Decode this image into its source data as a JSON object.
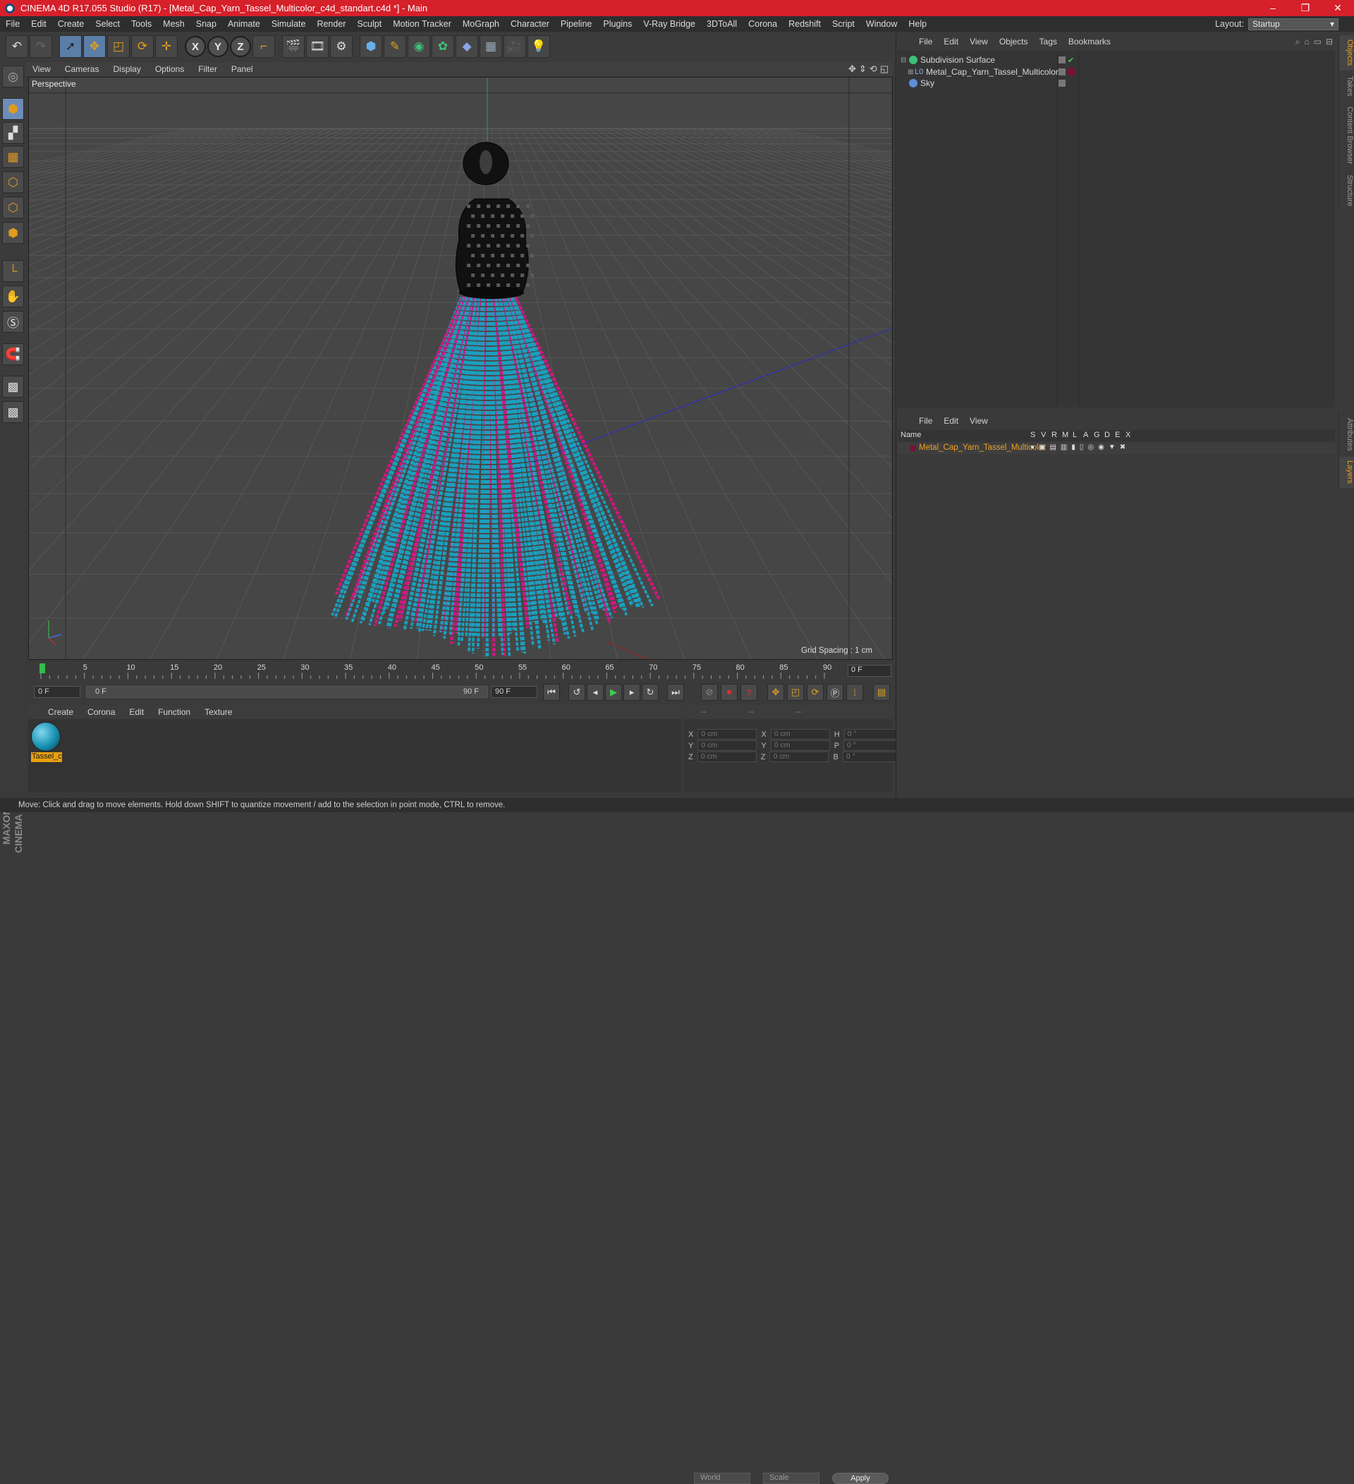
{
  "window": {
    "title": "CINEMA 4D R17.055 Studio (R17) - [Metal_Cap_Yarn_Tassel_Multicolor_c4d_standart.c4d *] - Main",
    "minimize": "–",
    "maximize": "❐",
    "close": "✕"
  },
  "menu": [
    "File",
    "Edit",
    "Create",
    "Select",
    "Tools",
    "Mesh",
    "Snap",
    "Animate",
    "Simulate",
    "Render",
    "Sculpt",
    "Motion Tracker",
    "MoGraph",
    "Character",
    "Pipeline",
    "Plugins",
    "V-Ray Bridge",
    "3DToAll",
    "Corona",
    "Redshift",
    "Script",
    "Window",
    "Help"
  ],
  "layout": {
    "label": "Layout:",
    "value": "Startup"
  },
  "viewport": {
    "menu": [
      "View",
      "Cameras",
      "Display",
      "Options",
      "Filter",
      "Panel"
    ],
    "label": "Perspective",
    "grid_spacing": "Grid Spacing : 1 cm",
    "colors": {
      "bg": "#464646",
      "grid": "#575757",
      "yarn_blue": "#1b9fbe",
      "yarn_pink": "#d0177f",
      "cap": "#111111"
    }
  },
  "timeline": {
    "ticks": [
      "0",
      "5",
      "10",
      "15",
      "20",
      "25",
      "30",
      "35",
      "40",
      "45",
      "50",
      "55",
      "60",
      "65",
      "70",
      "75",
      "80",
      "85",
      "90"
    ],
    "current_frame": "0 F",
    "start_field": "0 F",
    "range_start": "0 F",
    "range_end": "90 F",
    "end_field": "90 F"
  },
  "materials": {
    "menu": [
      "Create",
      "Corona",
      "Edit",
      "Function",
      "Texture"
    ],
    "items": [
      {
        "name": "Tassel_c"
      }
    ]
  },
  "coordinates": {
    "header": [
      "--",
      "--",
      "--"
    ],
    "rows": [
      {
        "a": "X",
        "v1": "0 cm",
        "b": "X",
        "v2": "0 cm",
        "c": "H",
        "v3": "0 °"
      },
      {
        "a": "Y",
        "v1": "0 cm",
        "b": "Y",
        "v2": "0 cm",
        "c": "P",
        "v3": "0 °"
      },
      {
        "a": "Z",
        "v1": "0 cm",
        "b": "Z",
        "v2": "0 cm",
        "c": "B",
        "v3": "0 °"
      }
    ],
    "world": "World",
    "scale": "Scale",
    "apply": "Apply"
  },
  "objects": {
    "menu": [
      "File",
      "Edit",
      "View",
      "Objects",
      "Tags",
      "Bookmarks"
    ],
    "tree": [
      {
        "name": "Subdivision Surface",
        "indent": 0
      },
      {
        "name": "Metal_Cap_Yarn_Tassel_Multicolor",
        "indent": 1
      },
      {
        "name": "Sky",
        "indent": 0
      }
    ]
  },
  "layers": {
    "menu": [
      "File",
      "Edit",
      "View"
    ],
    "columns": [
      "Name",
      "S",
      "V",
      "R",
      "M",
      "L",
      "A",
      "G",
      "D",
      "E",
      "X"
    ],
    "rows": [
      {
        "name": "Metal_Cap_Yarn_Tassel_Multicolor"
      }
    ]
  },
  "side_tabs": [
    "Objects",
    "Takes",
    "Content Browser",
    "Structure"
  ],
  "side_tabs2": [
    "Attributes",
    "Layers"
  ],
  "status": "Move: Click and drag to move elements. Hold down SHIFT to quantize movement / add to the selection in point mode, CTRL to remove."
}
